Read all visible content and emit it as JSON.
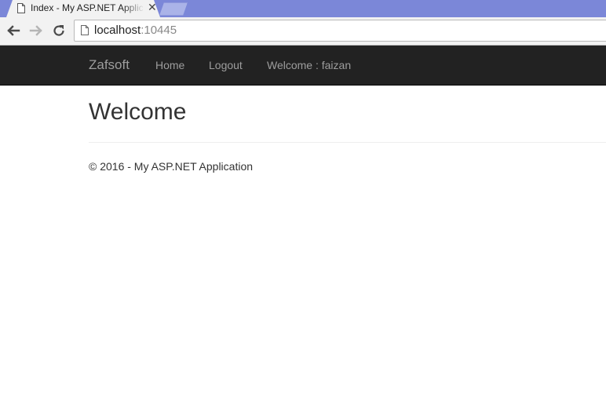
{
  "browser": {
    "tab": {
      "title": "Index - My ASP.NET Application",
      "close_glyph": "✕"
    },
    "address_bar": {
      "host": "localhost",
      "port": ":10445"
    }
  },
  "navbar": {
    "brand": "Zafsoft",
    "links": [
      "Home",
      "Logout"
    ],
    "welcome": "Welcome : faizan"
  },
  "main": {
    "heading": "Welcome"
  },
  "footer": {
    "text": "© 2016 - My ASP.NET Application"
  },
  "colors": {
    "navbar_bg": "#222222",
    "navbar_text": "#9d9d9d",
    "tabstrip_bg": "#7b87d8"
  }
}
